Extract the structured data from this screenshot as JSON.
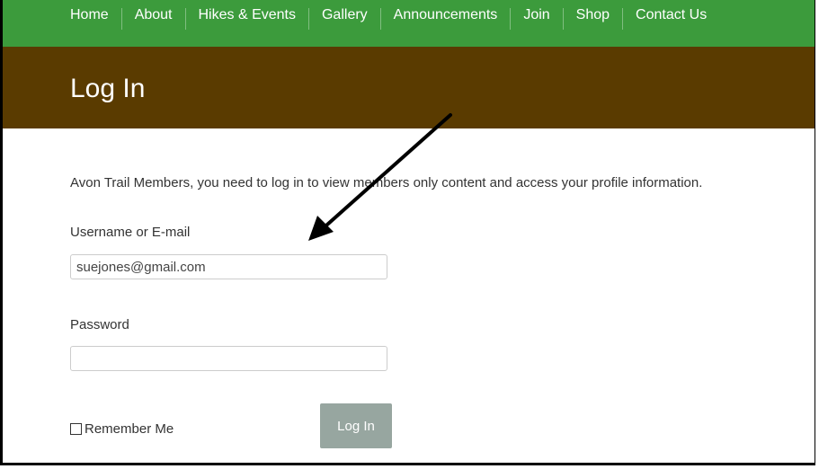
{
  "nav": {
    "items": [
      {
        "label": "Home"
      },
      {
        "label": "About"
      },
      {
        "label": "Hikes & Events"
      },
      {
        "label": "Gallery"
      },
      {
        "label": "Announcements"
      },
      {
        "label": "Join"
      },
      {
        "label": "Shop"
      },
      {
        "label": "Contact Us"
      }
    ]
  },
  "header": {
    "title": "Log In"
  },
  "login": {
    "intro": "Avon Trail Members, you need to log in to view members only content and access your profile information.",
    "username_label": "Username or E-mail",
    "username_value": "suejones@gmail.com",
    "password_label": "Password",
    "password_value": "",
    "remember_label": "Remember Me",
    "submit_label": "Log In"
  },
  "colors": {
    "nav_bg": "#3c9b3c",
    "header_bg": "#5a3b00",
    "button_bg": "#97a6a0"
  }
}
